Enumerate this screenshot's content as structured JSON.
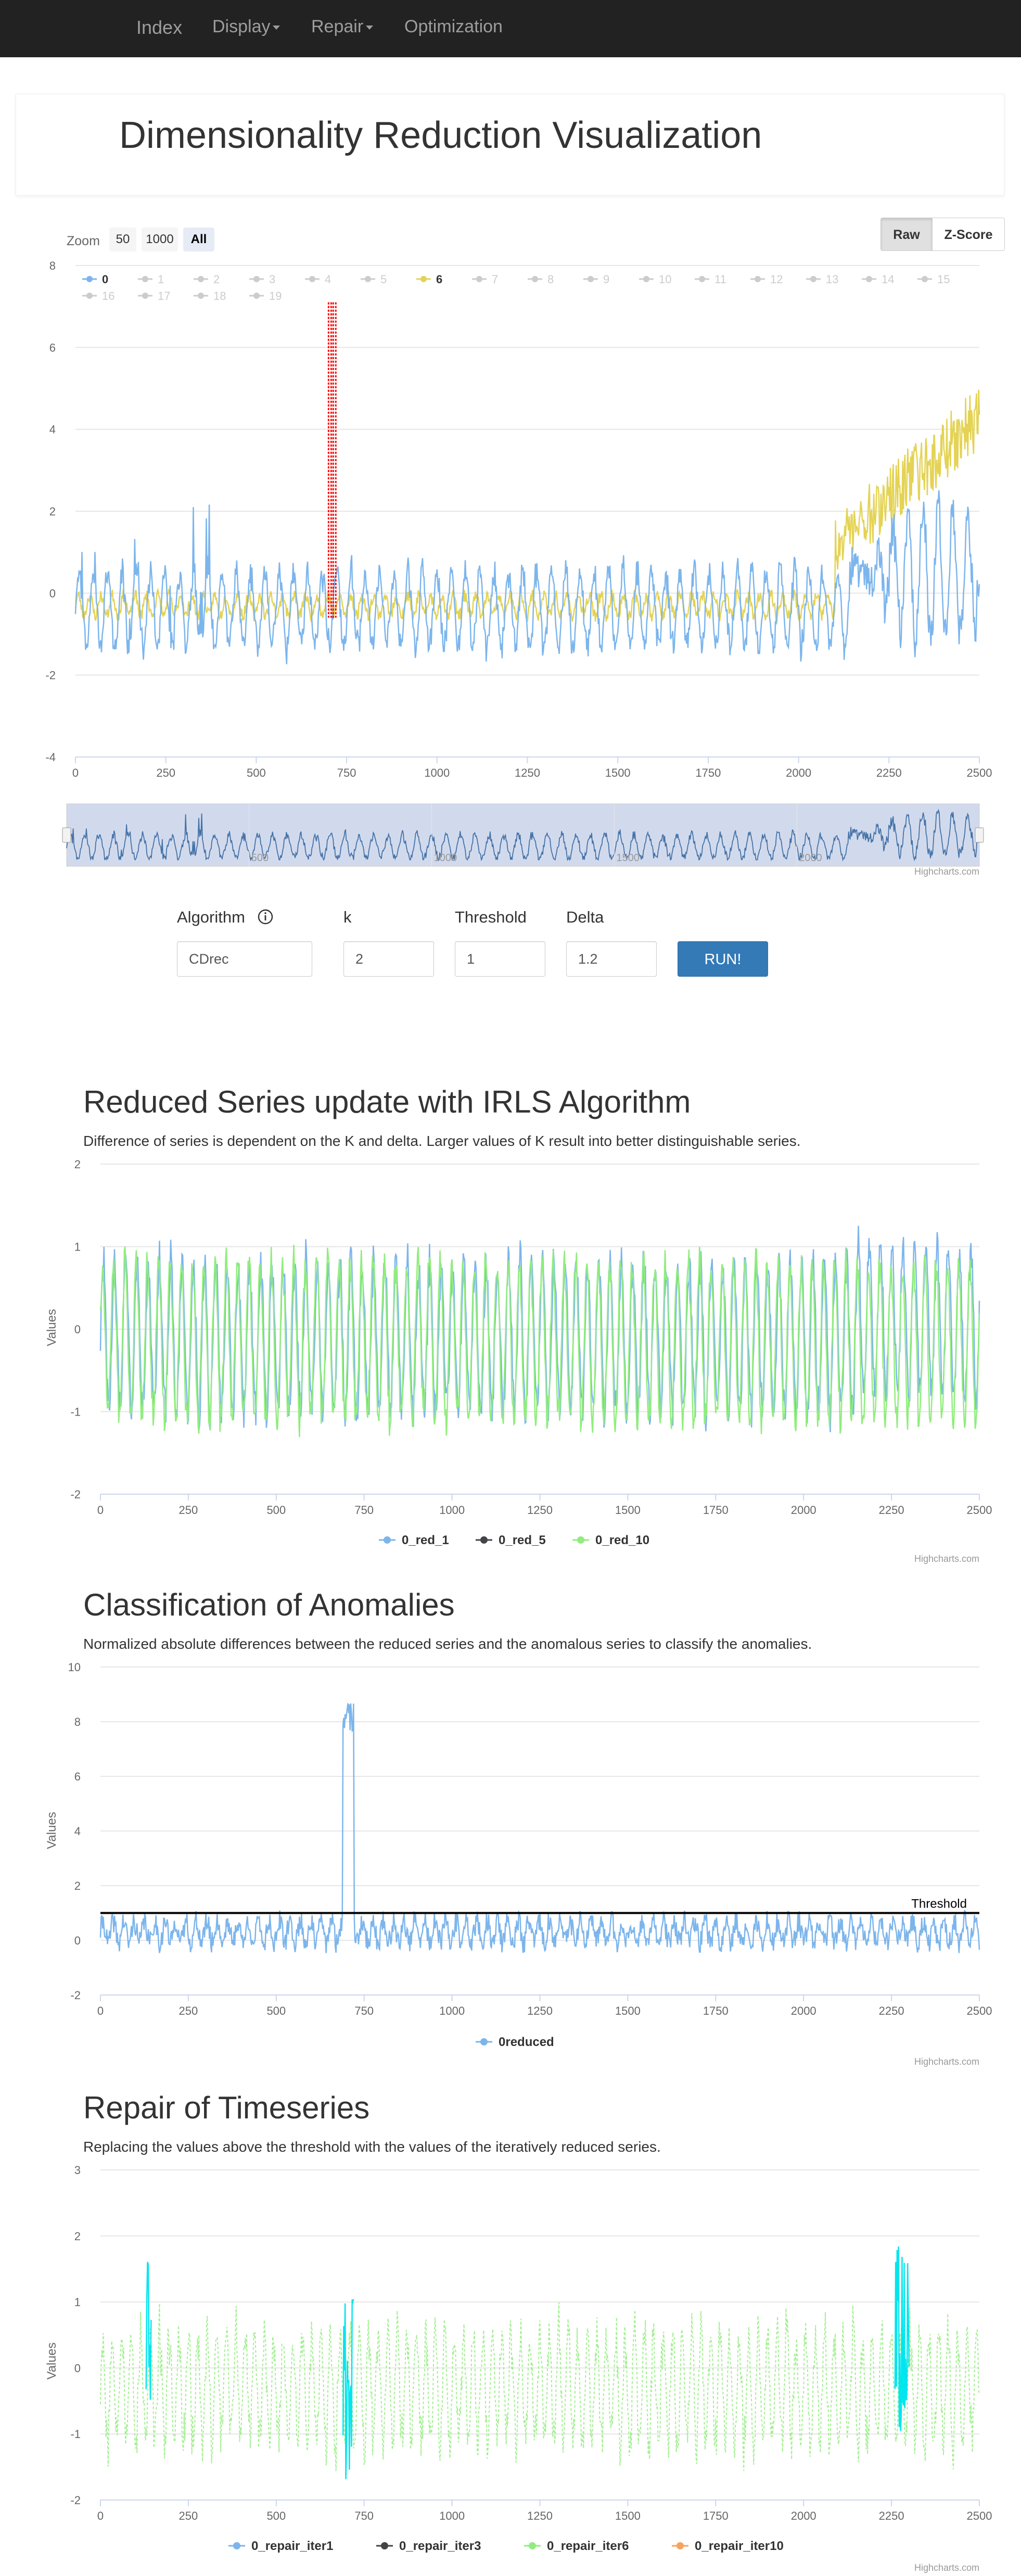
{
  "nav": {
    "brand": "Index",
    "items": [
      {
        "label": "Display",
        "dropdown": true
      },
      {
        "label": "Repair",
        "dropdown": true
      },
      {
        "label": "Optimization",
        "dropdown": false
      }
    ]
  },
  "page_title": "Dimensionality Reduction Visualization",
  "zoom": {
    "label": "Zoom",
    "options": [
      "50",
      "1000",
      "All"
    ],
    "selected": "All"
  },
  "view_toggle": {
    "options": [
      "Raw",
      "Z-Score"
    ],
    "selected": "Raw"
  },
  "form": {
    "algorithm": {
      "label": "Algorithm",
      "value": "CDrec",
      "icon": "info-icon"
    },
    "k": {
      "label": "k",
      "value": "2"
    },
    "threshold": {
      "label": "Threshold",
      "value": "1"
    },
    "delta": {
      "label": "Delta",
      "value": "1.2"
    },
    "run_label": "RUN!"
  },
  "credit": "Highcharts.com",
  "sections": [
    {
      "title": "Reduced Series update with IRLS Algorithm",
      "desc": "Difference of series is dependent on the K and delta. Larger values of K result into better distinguishable series."
    },
    {
      "title": "Classification of Anomalies",
      "desc": "Normalized absolute differences between the reduced series and the anomalous series to classify the anomalies."
    },
    {
      "title": "Repair of Timeseries",
      "desc": "Replacing the values above the threshold with the values of the iteratively reduced series."
    }
  ],
  "colors": {
    "blue": "#7cb5ec",
    "black": "#434348",
    "green": "#90ed7d",
    "orange": "#f7a35c",
    "yellow": "#e4d354",
    "red": "#ff0000",
    "cyan": "#00e5ee",
    "navbar": "#222222",
    "run_button": "#337ab7"
  },
  "chart_data": [
    {
      "type": "line",
      "id": "raw",
      "xlim": [
        0,
        2500
      ],
      "ylim": [
        -4,
        8
      ],
      "x_ticks": [
        0,
        250,
        500,
        750,
        1000,
        1250,
        1500,
        1750,
        2000,
        2250,
        2500
      ],
      "y_ticks": [
        -4,
        -2,
        0,
        2,
        4,
        6,
        8
      ],
      "legend": [
        {
          "name": "0",
          "visible": true,
          "color": "#7cb5ec"
        },
        {
          "name": "1",
          "visible": false
        },
        {
          "name": "2",
          "visible": false
        },
        {
          "name": "3",
          "visible": false
        },
        {
          "name": "4",
          "visible": false
        },
        {
          "name": "5",
          "visible": false
        },
        {
          "name": "6",
          "visible": true,
          "color": "#e4d354"
        },
        {
          "name": "7",
          "visible": false
        },
        {
          "name": "8",
          "visible": false
        },
        {
          "name": "9",
          "visible": false
        },
        {
          "name": "10",
          "visible": false
        },
        {
          "name": "11",
          "visible": false
        },
        {
          "name": "12",
          "visible": false
        },
        {
          "name": "13",
          "visible": false
        },
        {
          "name": "14",
          "visible": false
        },
        {
          "name": "15",
          "visible": false
        },
        {
          "name": "16",
          "visible": false
        },
        {
          "name": "17",
          "visible": false
        },
        {
          "name": "18",
          "visible": false
        },
        {
          "name": "19",
          "visible": false
        }
      ],
      "anomaly_range": [
        700,
        720
      ],
      "anomaly_peak": 7.1,
      "navigator_ticks": [
        500,
        1000,
        1500,
        2000
      ]
    },
    {
      "type": "line",
      "id": "reduced",
      "xlim": [
        0,
        2500
      ],
      "ylim": [
        -2,
        2
      ],
      "ylabel": "Values",
      "x_ticks": [
        0,
        250,
        500,
        750,
        1000,
        1250,
        1500,
        1750,
        2000,
        2250,
        2500
      ],
      "y_ticks": [
        -2,
        -1,
        0,
        1,
        2
      ],
      "series": [
        {
          "name": "0_red_1",
          "color": "#7cb5ec"
        },
        {
          "name": "0_red_5",
          "color": "#434348"
        },
        {
          "name": "0_red_10",
          "color": "#90ed7d"
        }
      ]
    },
    {
      "type": "line",
      "id": "classification",
      "xlim": [
        0,
        2500
      ],
      "ylim": [
        -2,
        10
      ],
      "ylabel": "Values",
      "x_ticks": [
        0,
        250,
        500,
        750,
        1000,
        1250,
        1500,
        1750,
        2000,
        2250,
        2500
      ],
      "y_ticks": [
        -2,
        0,
        2,
        4,
        6,
        8,
        10
      ],
      "threshold": 1,
      "threshold_label": "Threshold",
      "spike_range": [
        690,
        720
      ],
      "spike_peak": 8.7,
      "series": [
        {
          "name": "0reduced",
          "color": "#7cb5ec"
        }
      ]
    },
    {
      "type": "line",
      "id": "repair",
      "xlim": [
        0,
        2500
      ],
      "ylim": [
        -2,
        3
      ],
      "ylabel": "Values",
      "x_ticks": [
        0,
        250,
        500,
        750,
        1000,
        1250,
        1500,
        1750,
        2000,
        2250,
        2500
      ],
      "y_ticks": [
        -2,
        -1,
        0,
        1,
        2,
        3
      ],
      "repaired_ranges": [
        [
          130,
          145
        ],
        [
          690,
          720
        ],
        [
          2260,
          2300
        ]
      ],
      "series": [
        {
          "name": "0_repair_iter1",
          "color": "#7cb5ec"
        },
        {
          "name": "0_repair_iter3",
          "color": "#434348"
        },
        {
          "name": "0_repair_iter6",
          "color": "#90ed7d"
        },
        {
          "name": "0_repair_iter10",
          "color": "#f7a35c"
        }
      ]
    }
  ]
}
